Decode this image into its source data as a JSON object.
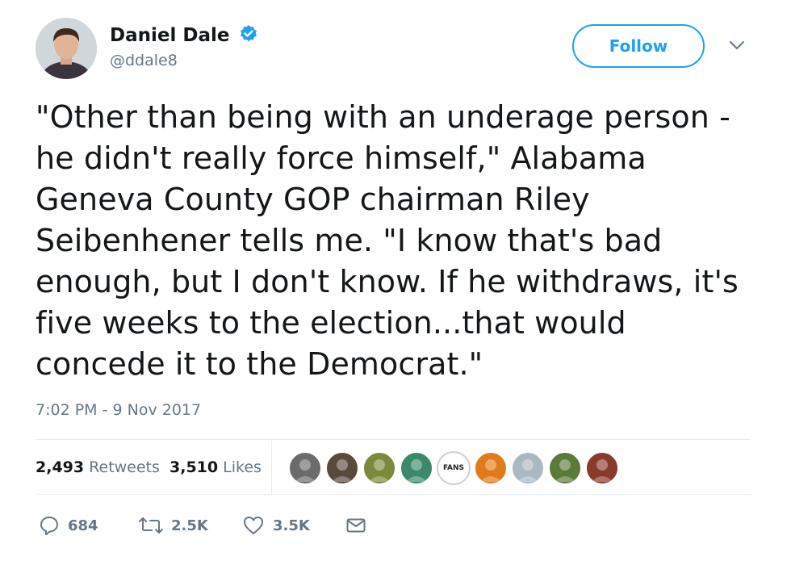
{
  "author": {
    "display_name": "Daniel Dale",
    "handle": "@ddale8",
    "verified": true
  },
  "follow_label": "Follow",
  "tweet": {
    "lines": [
      "\"Other than being with an underage person -",
      "he didn't really force himself,\" Alabama",
      "Geneva County GOP chairman Riley",
      "Seibenhener tells me. \"I know that's bad",
      "enough, but I don't know. If he withdraws, it's",
      "five weeks to the election...that would",
      "concede it to the Democrat.\""
    ]
  },
  "timestamp": "7:02 PM - 9 Nov 2017",
  "stats": {
    "retweets_count": "2,493",
    "retweets_label": "Retweets",
    "likes_count": "3,510",
    "likes_label": "Likes"
  },
  "likers": [
    {
      "name": "liker-avatar-1",
      "color": "#6b6b6b"
    },
    {
      "name": "liker-avatar-2",
      "color": "#5a4a3a"
    },
    {
      "name": "liker-avatar-3",
      "color": "#7a8a3a"
    },
    {
      "name": "liker-avatar-4",
      "color": "#3a8a6a"
    },
    {
      "name": "liker-avatar-5",
      "color": "#ffffff",
      "text": "FANS"
    },
    {
      "name": "liker-avatar-6",
      "color": "#e07a1a"
    },
    {
      "name": "liker-avatar-7",
      "color": "#aab8c2"
    },
    {
      "name": "liker-avatar-8",
      "color": "#5a7a3a"
    },
    {
      "name": "liker-avatar-9",
      "color": "#8a3a2a"
    }
  ],
  "actions": {
    "reply_count": "684",
    "retweet_count": "2.5K",
    "like_count": "3.5K"
  },
  "colors": {
    "brand_blue": "#1da1f2",
    "secondary_text": "#657786",
    "primary_text": "#14171a",
    "divider": "#e6ecf0"
  }
}
